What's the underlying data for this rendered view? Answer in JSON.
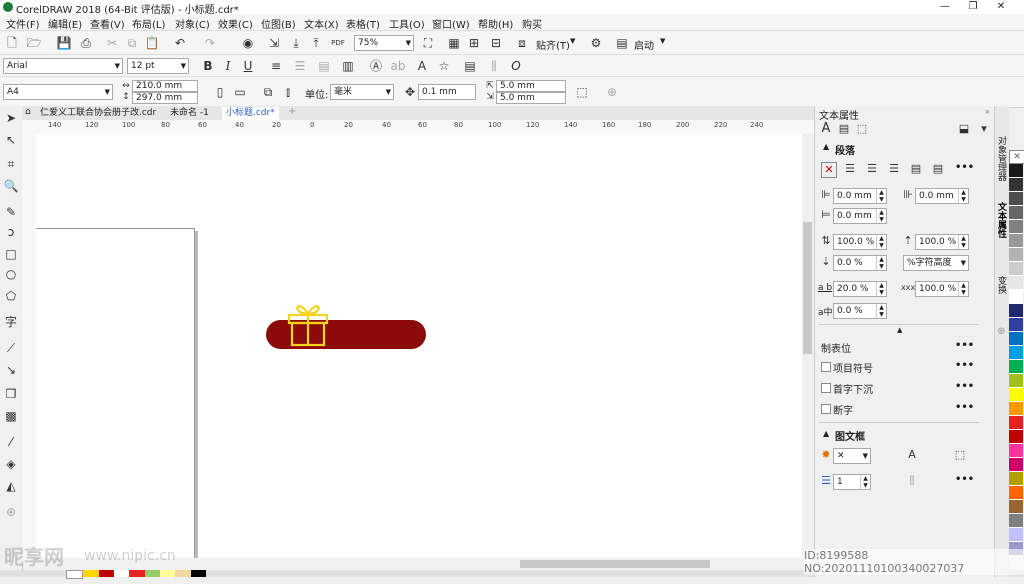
{
  "window": {
    "title": "CorelDRAW 2018 (64-Bit 评估版) - 小标题.cdr*",
    "minimize": "—",
    "maximize": "❐",
    "close": "✕"
  },
  "menu": [
    "文件(F)",
    "编辑(E)",
    "查看(V)",
    "布局(L)",
    "对象(C)",
    "效果(C)",
    "位图(B)",
    "文本(X)",
    "表格(T)",
    "工具(O)",
    "窗口(W)",
    "帮助(H)",
    "购买"
  ],
  "toolbar": {
    "zoom": "75%",
    "snap": "贴齐(T)",
    "launch": "启动"
  },
  "propbar": {
    "font": "Arial",
    "font_size": "12 pt"
  },
  "propbar2": {
    "page_size": "A4",
    "width": "210.0 mm",
    "height": "297.0 mm",
    "unit_label": "单位:",
    "unit": "毫米",
    "nudge": "0.1 mm",
    "dup_x": "5.0 mm",
    "dup_y": "5.0 mm"
  },
  "tabs": [
    "仁爱义工联合协会册子改.cdr",
    "未命名 -1",
    "小标题.cdr*"
  ],
  "ruler_labels": [
    "140",
    "120",
    "100",
    "80",
    "60",
    "40",
    "20",
    "0",
    "20",
    "40",
    "60",
    "80",
    "100",
    "120",
    "140",
    "160",
    "180",
    "200",
    "220",
    "240"
  ],
  "panel": {
    "title": "文本属性",
    "paragraph": "段落",
    "indent_first": "0.0 mm",
    "indent_left": "0.0 mm",
    "indent_right": "0.0 mm",
    "line_spacing": "100.0 %",
    "para_before": "100.0 %",
    "para_after": "0.0 %",
    "spacing_unit": "%字符高度",
    "char_spacing_label": "a b",
    "char_spacing": "20.0 %",
    "word_spacing": "100.0 %",
    "lang_spacing_label": "a中",
    "lang_spacing": "0.0 %",
    "tabs_label": "制表位",
    "bullets": "项目符号",
    "dropcap": "首字下沉",
    "hyphen": "断字",
    "frame": "图文框",
    "columns": "1"
  },
  "side_tabs": [
    "对象管理器",
    "文本属性",
    "变换"
  ],
  "palette": [
    "#1a1a1a",
    "#333333",
    "#4d4d4d",
    "#666666",
    "#808080",
    "#999999",
    "#b3b3b3",
    "#cccccc",
    "#e6e6e6",
    "#ffffff",
    "#1f2a6b",
    "#2f3f9f",
    "#0070c0",
    "#00a0e0",
    "#00b050",
    "#a0c020",
    "#ffff00",
    "#ff9900",
    "#e52222",
    "#c00000",
    "#ff3399",
    "#cc0066",
    "#b3a000",
    "#ff6600",
    "#996633",
    "#7f7f7f",
    "#c0c0ff",
    "#9999cc",
    "#666699",
    "#cccccc"
  ],
  "bottom_palette": [
    "#ffffff",
    "#ffd700",
    "#c00000",
    "#ffffff",
    "#e52222",
    "#99cc66",
    "#ffff99",
    "#f0d8a0",
    "#000000"
  ],
  "canvas": {
    "banner_color": "#8b0a0a",
    "gift_color": "#f2d51a"
  },
  "watermark": {
    "brand": "昵享网",
    "url": "www.nipic.cn",
    "id": "ID:8199588 NO:20201110100340027037"
  }
}
